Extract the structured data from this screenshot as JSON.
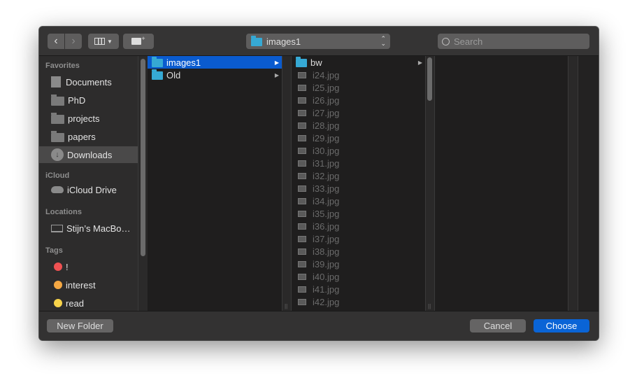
{
  "toolbar": {
    "back_icon": "chevron-left-icon",
    "forward_icon": "chevron-right-icon",
    "view_icon": "column-view-icon",
    "new_folder_icon": "new-folder-icon",
    "path": "images1",
    "search_placeholder": "Search"
  },
  "sidebar": {
    "sections": [
      {
        "title": "Favorites",
        "items": [
          {
            "label": "Documents",
            "icon": "document-icon"
          },
          {
            "label": "PhD",
            "icon": "folder-icon"
          },
          {
            "label": "projects",
            "icon": "folder-icon"
          },
          {
            "label": "papers",
            "icon": "folder-icon"
          },
          {
            "label": "Downloads",
            "icon": "download-icon",
            "selected": true
          }
        ]
      },
      {
        "title": "iCloud",
        "items": [
          {
            "label": "iCloud Drive",
            "icon": "cloud-icon"
          }
        ]
      },
      {
        "title": "Locations",
        "items": [
          {
            "label": "Stijn’s MacBo…",
            "icon": "laptop-icon"
          }
        ]
      },
      {
        "title": "Tags",
        "items": [
          {
            "label": "!",
            "color": "#ef5152"
          },
          {
            "label": "interest",
            "color": "#f5a843"
          },
          {
            "label": "read",
            "color": "#f8d34a"
          }
        ]
      }
    ]
  },
  "columns": [
    [
      {
        "name": "images1",
        "type": "folder",
        "selected": true
      },
      {
        "name": "Old",
        "type": "folder"
      }
    ],
    [
      {
        "name": "bw",
        "type": "folder"
      },
      {
        "name": "i24.jpg"
      },
      {
        "name": "i25.jpg"
      },
      {
        "name": "i26.jpg"
      },
      {
        "name": "i27.jpg"
      },
      {
        "name": "i28.jpg"
      },
      {
        "name": "i29.jpg"
      },
      {
        "name": "i30.jpg"
      },
      {
        "name": "i31.jpg"
      },
      {
        "name": "i32.jpg"
      },
      {
        "name": "i33.jpg"
      },
      {
        "name": "i34.jpg"
      },
      {
        "name": "i35.jpg"
      },
      {
        "name": "i36.jpg"
      },
      {
        "name": "i37.jpg"
      },
      {
        "name": "i38.jpg"
      },
      {
        "name": "i39.jpg"
      },
      {
        "name": "i40.jpg"
      },
      {
        "name": "i41.jpg"
      },
      {
        "name": "i42.jpg"
      }
    ]
  ],
  "footer": {
    "new_folder": "New Folder",
    "cancel": "Cancel",
    "choose": "Choose"
  },
  "colors": {
    "accent": "#0a64d6",
    "selection": "#0a5bcf",
    "folder": "#36a9d4"
  }
}
